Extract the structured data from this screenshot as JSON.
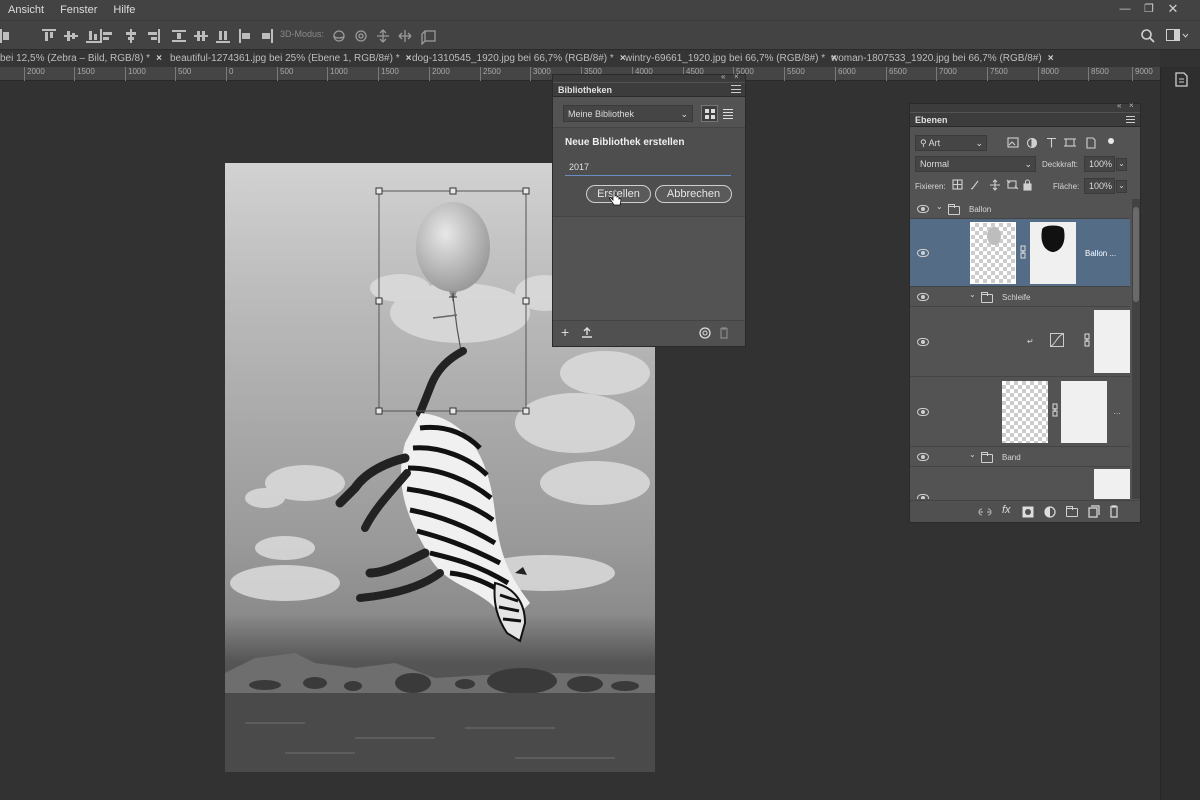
{
  "menu": {
    "items": [
      "Ansicht",
      "Fenster",
      "Hilfe"
    ]
  },
  "optionsbar": {
    "mode3d": "3D-Modus:"
  },
  "tabs": [
    {
      "label": "bei 12,5% (Zebra – Bild, RGB/8) *",
      "close": "×"
    },
    {
      "label": "beautiful-1274361.jpg bei 25% (Ebene 1, RGB/8#) *",
      "close": "×"
    },
    {
      "label": "dog-1310545_1920.jpg bei 66,7% (RGB/8#) *",
      "close": "×"
    },
    {
      "label": "wintry-69661_1920.jpg bei 66,7% (RGB/8#) *",
      "close": "×"
    },
    {
      "label": "woman-1807533_1920.jpg bei 66,7% (RGB/8#)",
      "close": "×"
    }
  ],
  "ruler": {
    "ticks": [
      "2000",
      "1500",
      "1000",
      "500",
      "0",
      "500",
      "1000",
      "1500",
      "2000",
      "2500",
      "3000",
      "3500",
      "4000",
      "4500",
      "5000",
      "5500",
      "6000",
      "6500",
      "7000",
      "7500",
      "8000",
      "8500",
      "9000"
    ]
  },
  "libraries": {
    "title": "Bibliotheken",
    "library_select": "Meine Bibliothek",
    "create_heading": "Neue Bibliothek erstellen",
    "name_value": "2017",
    "create_button": "Erstellen",
    "cancel_button": "Abbrechen"
  },
  "layers": {
    "title": "Ebenen",
    "filter_kind": "Art",
    "blend_mode": "Normal",
    "opacity_label": "Deckkraft:",
    "opacity_value": "100%",
    "lock_label": "Fixieren:",
    "fill_label": "Fläche:",
    "fill_value": "100%",
    "group_balloon": "Ballon",
    "layer_balloon": "Ballon ...",
    "group_bow": "Schleife",
    "group_band": "Band",
    "fx_label": "fx"
  },
  "colors": {
    "accent": "#556c86",
    "panel": "#535353",
    "canvas": "#323232"
  }
}
